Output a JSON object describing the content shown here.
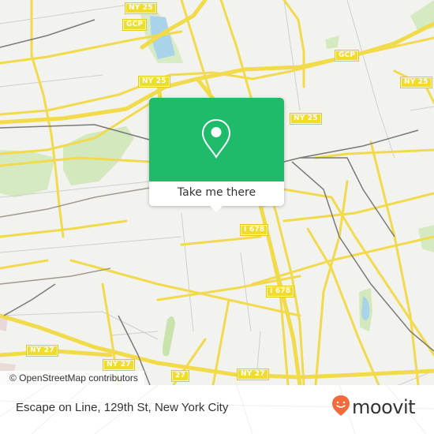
{
  "map": {
    "attribution": "© OpenStreetMap contributors",
    "colors": {
      "background": "#f2f2ef",
      "road": "#f4de5a",
      "road_casing": "#e6cc3a",
      "park": "#cfe6b8",
      "water": "#a9d3e8",
      "rail": "#7a7a7a",
      "minor": "#c8c8c8"
    },
    "route_shields": [
      {
        "label": "NY 25",
        "name": "shield-ny25-top"
      },
      {
        "label": "GCP",
        "name": "shield-gcp-left"
      },
      {
        "label": "GCP",
        "name": "shield-gcp-right"
      },
      {
        "label": "NY 25",
        "name": "shield-ny25-center"
      },
      {
        "label": "NY 25",
        "name": "shield-ny25-right"
      },
      {
        "label": "NY 25",
        "name": "shield-ny25-mid"
      },
      {
        "label": "I 678",
        "name": "shield-i678-upper"
      },
      {
        "label": "I 678",
        "name": "shield-i678-lower"
      },
      {
        "label": "NY 27",
        "name": "shield-ny27-left"
      },
      {
        "label": "NY 27",
        "name": "shield-ny27-center"
      },
      {
        "label": "27",
        "name": "shield-27-partial"
      },
      {
        "label": "NY 27",
        "name": "shield-ny27-right"
      }
    ]
  },
  "popup": {
    "button_label": "Take me there",
    "icon": "map-pin-icon",
    "accent_color": "#1ebb6b"
  },
  "footer": {
    "place_name": "Escape on Line, 129th St, New York City",
    "brand": "moovit",
    "brand_color": "#f26b3a"
  }
}
